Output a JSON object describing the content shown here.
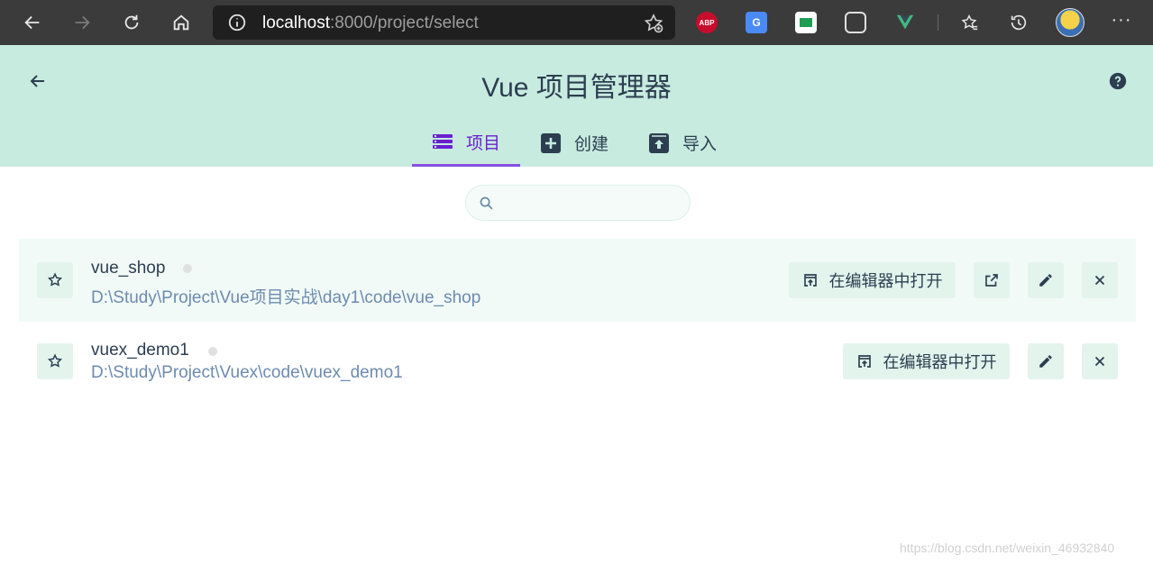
{
  "browser": {
    "url_host": "localhost",
    "url_path": ":8000/project/select",
    "extensions": {
      "abp_label": "ABP",
      "translate_label": "G"
    }
  },
  "header": {
    "title": "Vue 项目管理器",
    "tabs": [
      {
        "label": "项目",
        "icon": "list-icon",
        "active": true
      },
      {
        "label": "创建",
        "icon": "add-box-icon",
        "active": false
      },
      {
        "label": "导入",
        "icon": "unarchive-icon",
        "active": false
      }
    ]
  },
  "search": {
    "placeholder": "",
    "value": ""
  },
  "projects": [
    {
      "name": "vue_shop",
      "path": "D:\\Study\\Project\\Vue项目实战\\day1\\code\\vue_shop",
      "open_in_editor_label": "在编辑器中打开",
      "highlighted": true,
      "has_external_link": true
    },
    {
      "name": "vuex_demo1",
      "path": "D:\\Study\\Project\\Vuex\\code\\vuex_demo1",
      "open_in_editor_label": "在编辑器中打开",
      "highlighted": false,
      "has_external_link": false
    }
  ],
  "watermark": "https://blog.csdn.net/weixin_46932840",
  "colors": {
    "header_bg": "#c8ebe0",
    "active_tab": "#6a1fd0",
    "button_bg": "#e3f4ed",
    "path_text": "#6d8bb0",
    "browser_bar": "#3b3b3b"
  }
}
